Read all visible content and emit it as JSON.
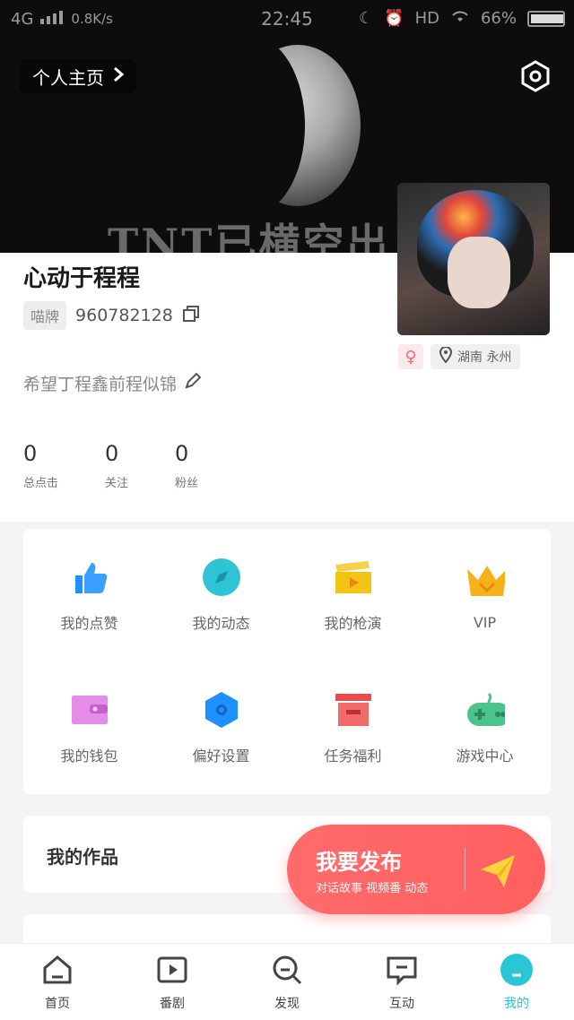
{
  "statusbar": {
    "network": "4G",
    "speed": "0.8K/s",
    "time": "22:45",
    "hd": "HD",
    "battery": "66%"
  },
  "header": {
    "home_link": "个人主页",
    "banner_text": "TNT已横空出"
  },
  "profile": {
    "name": "心动于程程",
    "id_tag": "喵牌",
    "id": "960782128",
    "gender_symbol": "♀",
    "location": "湖南 永州",
    "signature": "希望丁程鑫前程似锦"
  },
  "stats": [
    {
      "value": "0",
      "label": "总点击"
    },
    {
      "value": "0",
      "label": "关注"
    },
    {
      "value": "0",
      "label": "粉丝"
    }
  ],
  "grid": [
    {
      "label": "我的点赞",
      "icon": "thumbs-up-icon",
      "color": "#1e90ff"
    },
    {
      "label": "我的动态",
      "icon": "compass-icon",
      "color": "#2ec4d6"
    },
    {
      "label": "我的枪演",
      "icon": "clapperboard-icon",
      "color": "#f3c315"
    },
    {
      "label": "VIP",
      "icon": "crown-icon",
      "color": "#f5b21b"
    },
    {
      "label": "我的钱包",
      "icon": "wallet-icon",
      "color": "#e58be8"
    },
    {
      "label": "偏好设置",
      "icon": "hexagon-settings-icon",
      "color": "#1e90ff"
    },
    {
      "label": "任务福利",
      "icon": "gift-box-icon",
      "color": "#f26b6b"
    },
    {
      "label": "游戏中心",
      "icon": "gamepad-icon",
      "color": "#4cc38a"
    }
  ],
  "works": {
    "title": "我的作品"
  },
  "publish": {
    "title": "我要发布",
    "subtitle": "对话故事 视频番 动态"
  },
  "bottomnav": [
    {
      "label": "首页",
      "icon": "home-icon"
    },
    {
      "label": "番剧",
      "icon": "play-icon"
    },
    {
      "label": "发现",
      "icon": "search-icon"
    },
    {
      "label": "互动",
      "icon": "chat-icon"
    },
    {
      "label": "我的",
      "icon": "profile-icon"
    }
  ],
  "accent": "#29c7d6"
}
